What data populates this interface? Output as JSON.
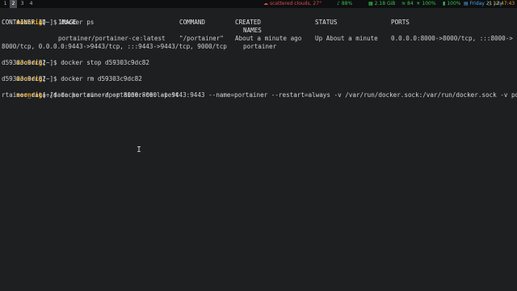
{
  "topbar": {
    "workspaces": [
      "1",
      "2",
      "3",
      "4"
    ],
    "active_workspace": "2",
    "weather": "scattered clouds, 27°",
    "volume": "88%",
    "memory": "2.18 GiB",
    "wifi": "84",
    "brightness": "100%",
    "battery": "100%",
    "date": "Friday 21 July",
    "time": "12:47:43",
    "colors": {
      "weather": "#e04a4a",
      "green": "#36c14f",
      "date": "#49a6e8",
      "time": "#e0a030"
    }
  },
  "terminal": {
    "prompt": {
      "host": "moonrig",
      "open": "[",
      "path": "~",
      "close": "]$"
    },
    "commands": {
      "ps": " docker ps",
      "stop": " docker stop d59303c9dc82",
      "rm": " docker rm d59303c9dc82",
      "run": " docker run -d -p 8000:8000 -p 9443:9443 --name=portainer --restart=always -v /var/run/docker.sock:/var/run/docker.sock -v po",
      "run_wrap": "rtainer_data:/data portainer/portainer-ce:latest"
    },
    "table": {
      "headers": {
        "container_id": "CONTAINER ID",
        "image": "IMAGE",
        "command": "COMMAND",
        "created": "CREATED",
        "status": "STATUS",
        "ports": "PORTS",
        "names": "NAMES"
      },
      "row": {
        "image": "portainer/portainer-ce:latest",
        "command": "\"/portainer\"",
        "created": "About a minute ago",
        "status": "Up About a minute",
        "ports": "0.0.0.0:8000->8000/tcp, :::8000->",
        "ports_wrap": "8000/tcp, 0.0.0.0:9443->9443/tcp, :::9443->9443/tcp, 9000/tcp",
        "names": "portainer"
      }
    },
    "outputs": {
      "stop": "d59303c9dc82",
      "rm": "d59303c9dc82"
    }
  },
  "cursor": "I"
}
